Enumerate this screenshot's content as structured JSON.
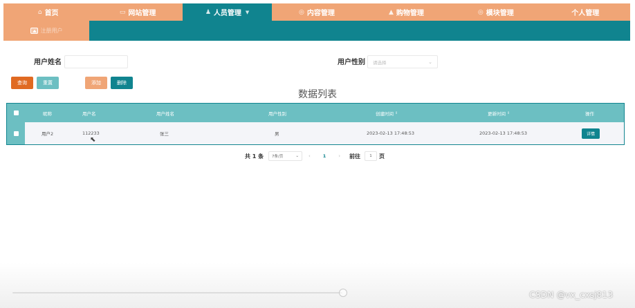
{
  "nav": {
    "items": [
      {
        "label": "首页",
        "icon": "⌂",
        "icon_name": "home-icon"
      },
      {
        "label": "网站管理",
        "icon": "▭",
        "icon_name": "monitor-icon"
      },
      {
        "label": "人员管理",
        "icon": "♟",
        "icon_name": "user-icon",
        "caret": "▼"
      },
      {
        "label": "内容管理",
        "icon": "◎",
        "icon_name": "content-icon"
      },
      {
        "label": "购物管理",
        "icon": "▲",
        "icon_name": "lock-icon"
      },
      {
        "label": "模块管理",
        "icon": "◎",
        "icon_name": "module-icon"
      },
      {
        "label": "个人管理",
        "icon": "",
        "icon_name": ""
      }
    ],
    "active_index": 2
  },
  "subnav": {
    "label": "注册用户"
  },
  "search": {
    "username_label": "用户姓名",
    "username_placeholder": "",
    "gender_label": "用户性别",
    "gender_placeholder": "请选择"
  },
  "buttons": {
    "query": "查询",
    "reset": "重置",
    "add": "添加",
    "delete": "删除"
  },
  "list_title": "数据列表",
  "table": {
    "headers": {
      "nickname": "昵称",
      "username": "用户名",
      "realname": "用户姓名",
      "gender": "用户性别",
      "created": "创建时间",
      "updated": "更新时间",
      "action": "操作"
    },
    "sort_glyph": "⇕",
    "row": {
      "nickname": "用户2",
      "username": "112233",
      "realname": "张三",
      "gender": "男",
      "created": "2023-02-13 17:48:53",
      "updated": "2023-02-13 17:48:53",
      "action": "详情"
    }
  },
  "pagination": {
    "total": "共 1 条",
    "page_size": "7条/页",
    "prev": "‹",
    "current": "1",
    "next": "›",
    "goto": "前往",
    "goto_value": "1",
    "page_unit": "页"
  },
  "watermark": "CSDN @vx_cxsj813",
  "colors": {
    "accent": "#10848f",
    "nav_bg": "#f0a576",
    "header_bg": "#6cbfc2",
    "query_btn": "#e06a22"
  }
}
